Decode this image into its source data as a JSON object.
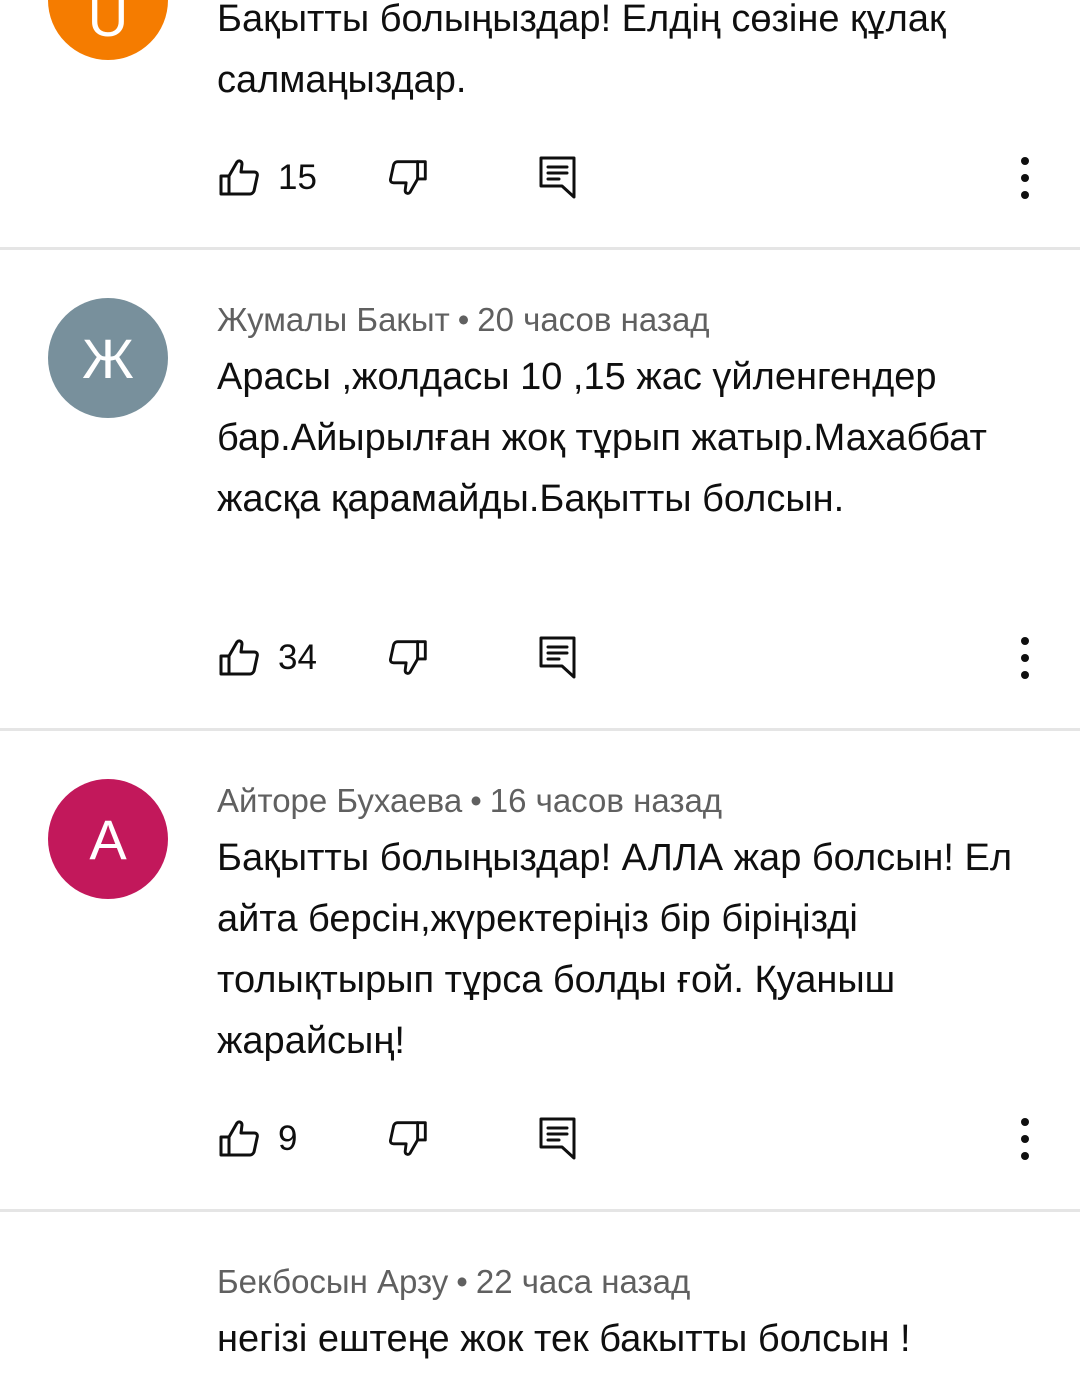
{
  "comments": [
    {
      "author": "",
      "time": "",
      "avatar_letter": "U",
      "avatar_color": "#f57c00",
      "text": "Бақытты болыңыздар! Елдің сөзіне құлақ салмаңыздар.",
      "likes": "15"
    },
    {
      "author": "Жумалы Бакыт",
      "time": "20 часов назад",
      "avatar_letter": "Ж",
      "avatar_color": "#78909c",
      "text": "Арасы ,жолдасы 10 ,15 жас үйленгендер бар.Айырылған  жоқ тұрып жатыр.Махаббат жасқа қарамайды.Бақытты болсын.",
      "likes": "34"
    },
    {
      "author": "Айторе Бухаева",
      "time": "16 часов назад",
      "avatar_letter": "А",
      "avatar_color": "#c2185b",
      "text": "Бақытты болыңыздар! АЛЛА жар болсын!  Ел айта берсін,жүректеріңіз бір біріңізді толықтырып тұрса болды ғой. Қуаныш жарайсың!",
      "likes": "9"
    },
    {
      "author": "Бекбосын Арзу",
      "time": "22 часа назад",
      "text": "негізі ештеңе жок тек бакытты болсын !"
    }
  ],
  "meta_separator": "•",
  "icons": {
    "like": "thumb-up-icon",
    "dislike": "thumb-down-icon",
    "reply": "reply-comment-icon",
    "more": "more-vertical-icon"
  }
}
